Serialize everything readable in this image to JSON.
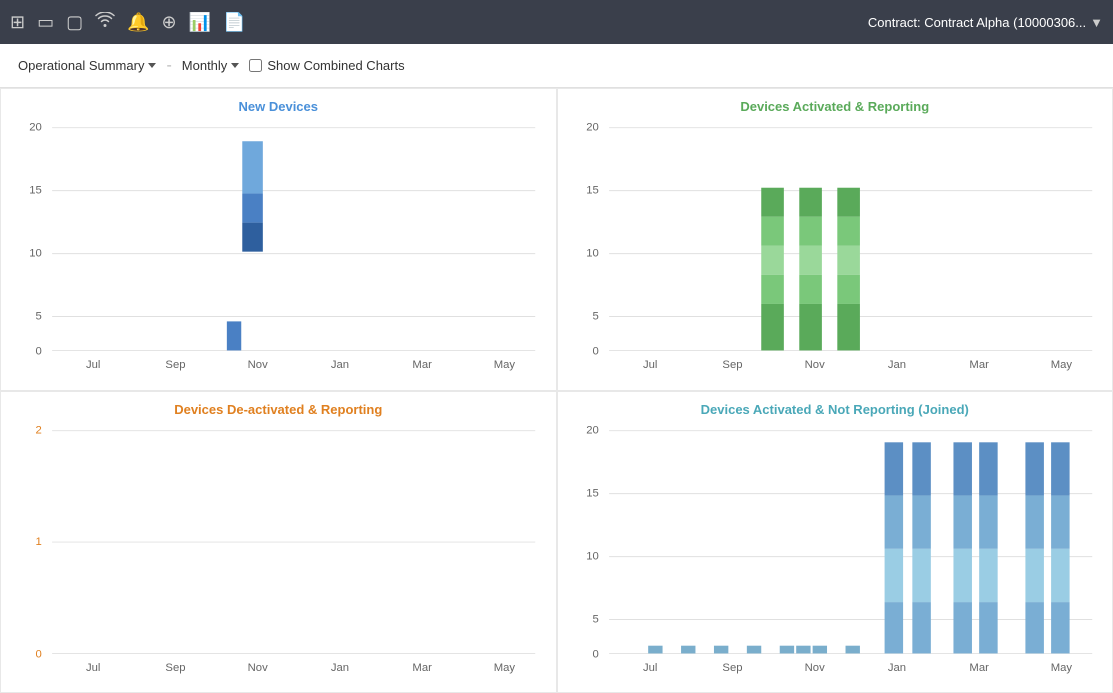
{
  "toolbar": {
    "contract_label": "Contract: Contract Alpha (10000306...",
    "icons": [
      "grid-icon",
      "window-icon",
      "monitor-icon",
      "wifi-icon",
      "bell-icon",
      "plus-icon",
      "chart-icon",
      "doc-icon"
    ]
  },
  "controls": {
    "summary_label": "Operational Summary",
    "period_label": "Monthly",
    "combined_label": "Show Combined Charts"
  },
  "charts": {
    "new_devices": {
      "title": "New Devices",
      "color": "blue",
      "x_labels": [
        "Jul",
        "Sep",
        "Nov",
        "Jan",
        "Mar",
        "May"
      ],
      "y_max": 20,
      "y_labels": [
        "0",
        "5",
        "10",
        "15",
        "20"
      ]
    },
    "devices_activated_reporting": {
      "title": "Devices Activated & Reporting",
      "color": "green",
      "x_labels": [
        "Jul",
        "Sep",
        "Nov",
        "Jan",
        "Mar",
        "May"
      ],
      "y_max": 20,
      "y_labels": [
        "0",
        "5",
        "10",
        "15",
        "20"
      ]
    },
    "devices_deactivated": {
      "title": "Devices De-activated & Reporting",
      "color": "orange",
      "x_labels": [
        "Jul",
        "Sep",
        "Nov",
        "Jan",
        "Mar",
        "May"
      ],
      "y_max": 2,
      "y_labels": [
        "0",
        "1",
        "2"
      ]
    },
    "devices_not_reporting": {
      "title": "Devices Activated & Not Reporting (Joined)",
      "color": "teal",
      "x_labels": [
        "Jul",
        "Sep",
        "Nov",
        "Jan",
        "Mar",
        "May"
      ],
      "y_max": 20,
      "y_labels": [
        "0",
        "5",
        "10",
        "15",
        "20"
      ]
    }
  }
}
